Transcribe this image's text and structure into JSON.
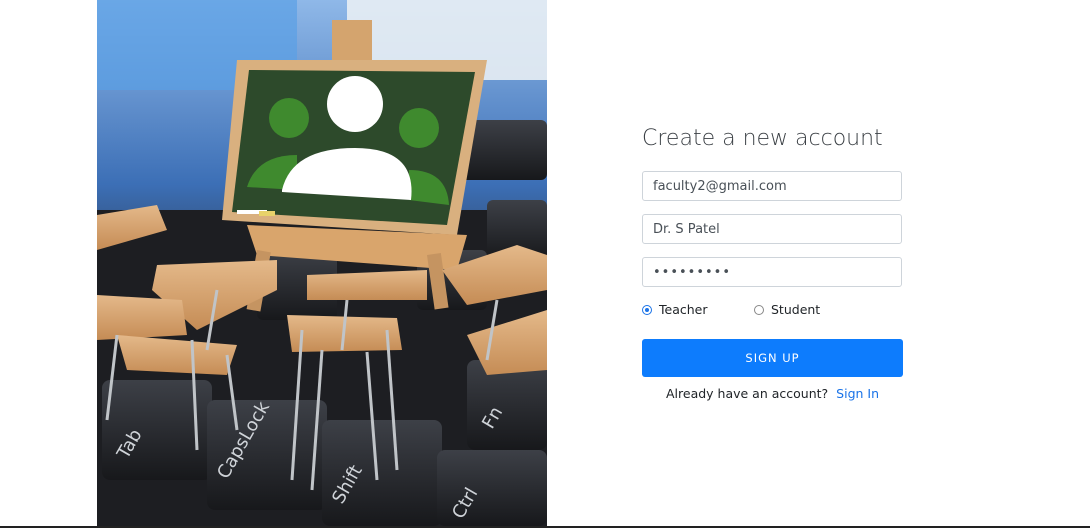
{
  "signup": {
    "title": "Create a new account",
    "email_value": "faculty2@gmail.com",
    "name_value": "Dr. S Patel",
    "password_mask": "•••••••••",
    "role_options": [
      "Teacher",
      "Student"
    ],
    "selected_role": "Teacher",
    "submit_label": "SIGN UP",
    "signin_prompt": "Already have an account?",
    "signin_link": "Sign In"
  },
  "hero": {
    "key_labels": [
      "Tab",
      "CapsLock",
      "Shift",
      "Ctrl",
      "Fn"
    ]
  },
  "colors": {
    "accent": "#0d7cfd",
    "link": "#1a73e8",
    "board": "#2d4a2b"
  }
}
